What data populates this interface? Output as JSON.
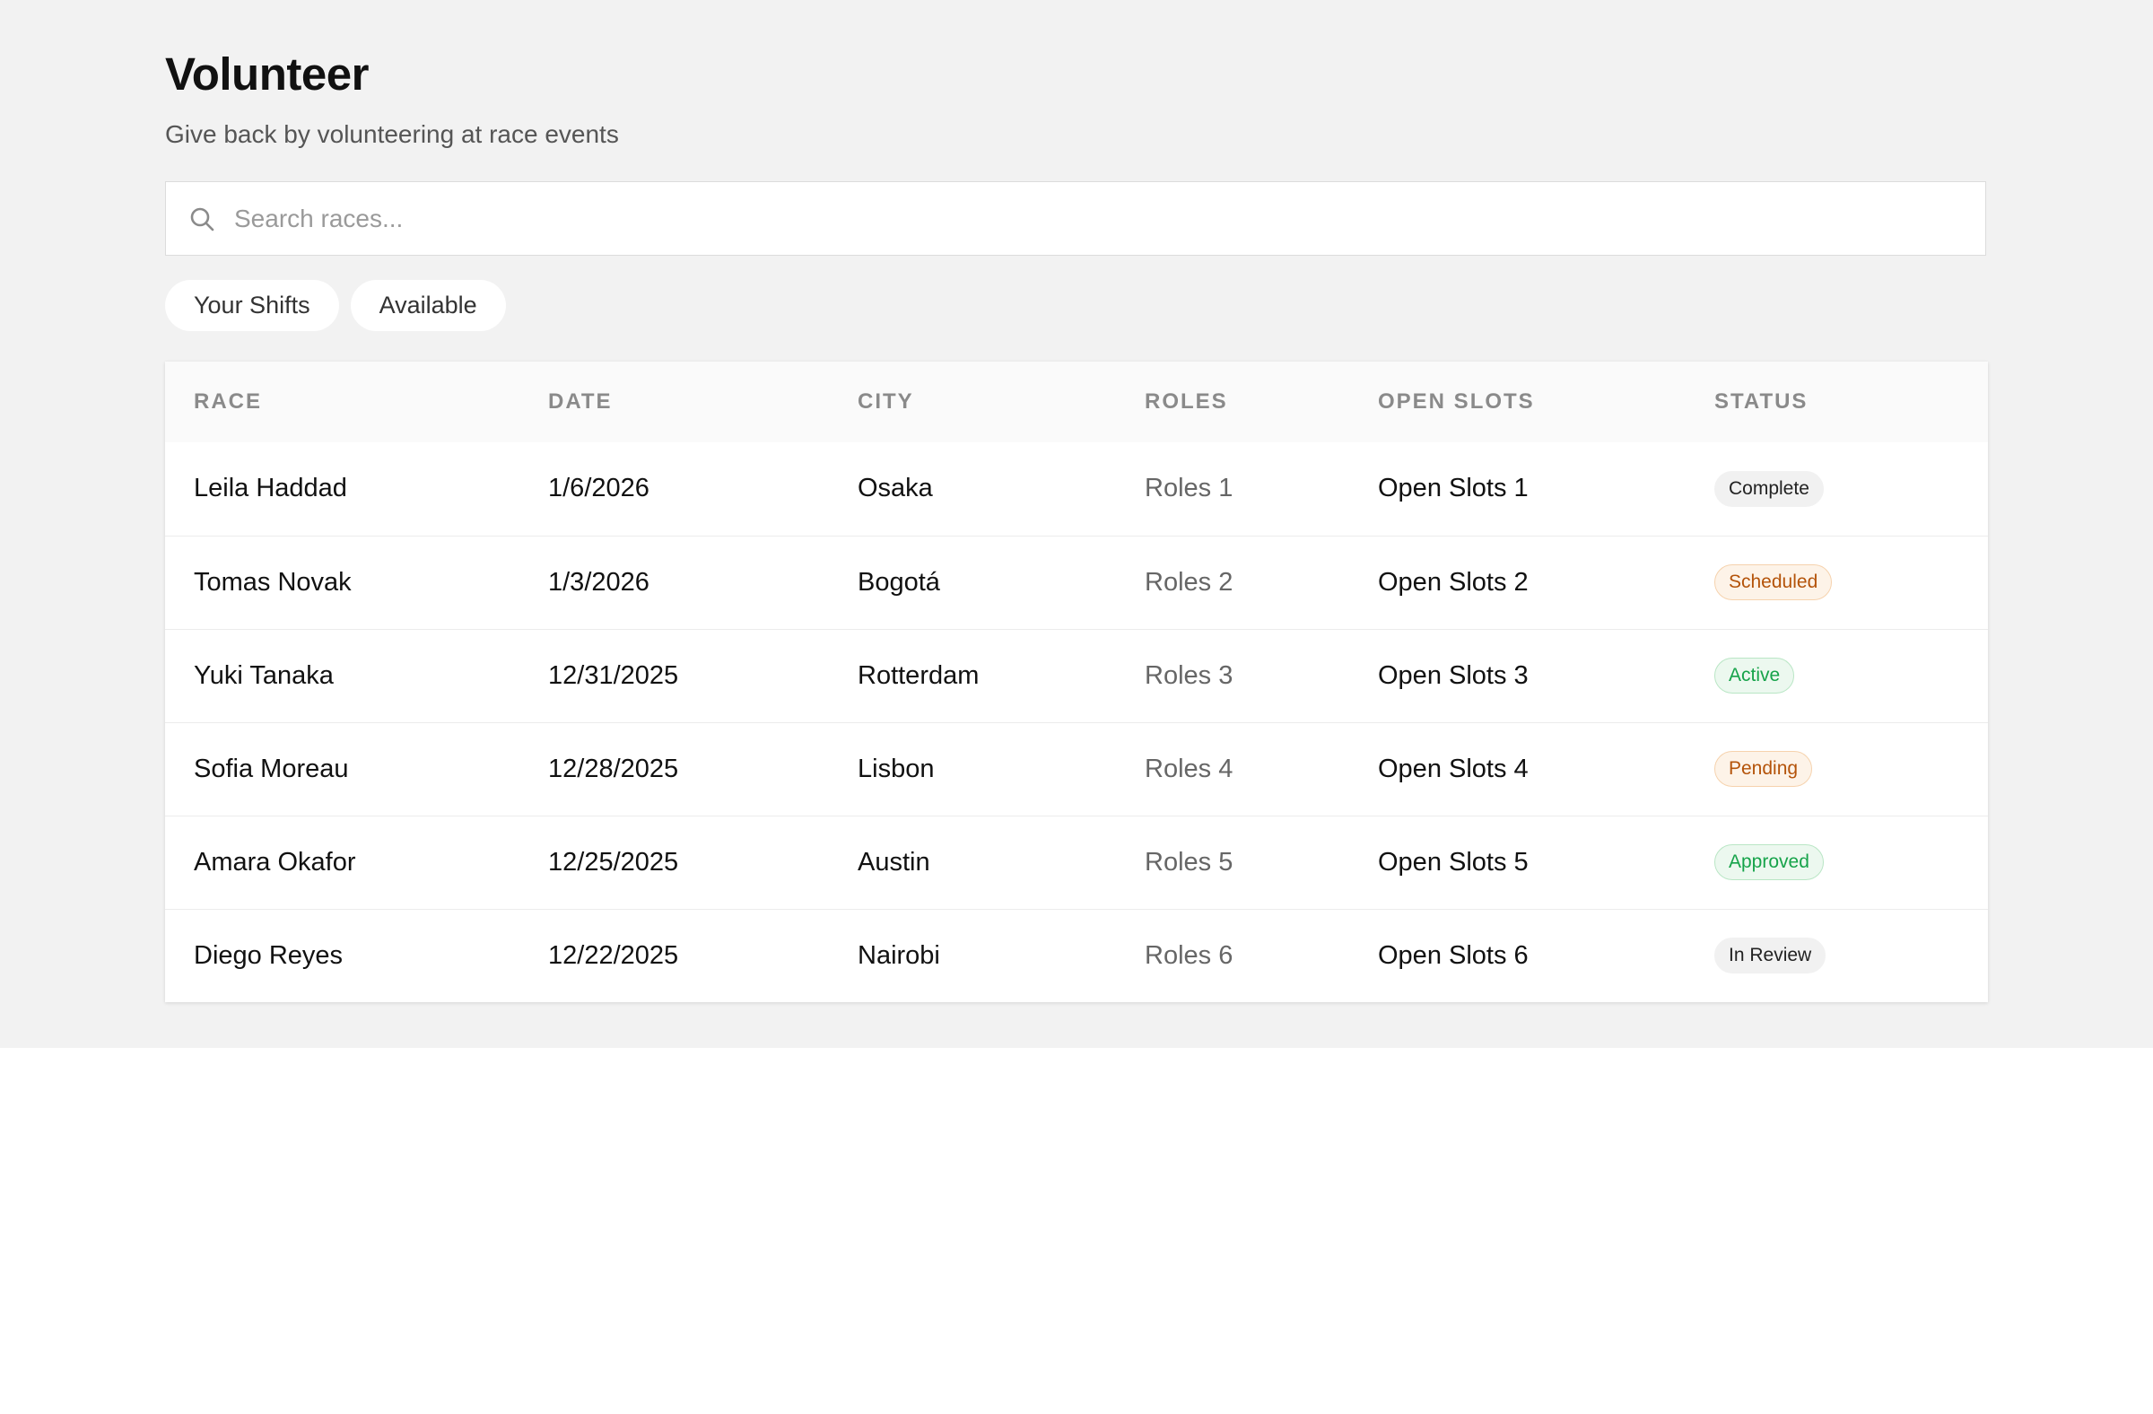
{
  "header": {
    "title": "Volunteer",
    "subtitle": "Give back by volunteering at race events"
  },
  "search": {
    "placeholder": "Search races...",
    "value": "",
    "icon": "search-icon"
  },
  "tabs": [
    {
      "label": "Your Shifts"
    },
    {
      "label": "Available"
    }
  ],
  "table": {
    "columns": [
      "RACE",
      "DATE",
      "CITY",
      "ROLES",
      "OPEN SLOTS",
      "STATUS"
    ],
    "rows": [
      {
        "race": "Leila Haddad",
        "date": "1/6/2026",
        "city": "Osaka",
        "roles": "Roles 1",
        "open_slots": "Open Slots 1",
        "status": "Complete"
      },
      {
        "race": "Tomas Novak",
        "date": "1/3/2026",
        "city": "Bogotá",
        "roles": "Roles 2",
        "open_slots": "Open Slots 2",
        "status": "Scheduled"
      },
      {
        "race": "Yuki Tanaka",
        "date": "12/31/2025",
        "city": "Rotterdam",
        "roles": "Roles 3",
        "open_slots": "Open Slots 3",
        "status": "Active"
      },
      {
        "race": "Sofia Moreau",
        "date": "12/28/2025",
        "city": "Lisbon",
        "roles": "Roles 4",
        "open_slots": "Open Slots 4",
        "status": "Pending"
      },
      {
        "race": "Amara Okafor",
        "date": "12/25/2025",
        "city": "Austin",
        "roles": "Roles 5",
        "open_slots": "Open Slots 5",
        "status": "Approved"
      },
      {
        "race": "Diego Reyes",
        "date": "12/22/2025",
        "city": "Nairobi",
        "roles": "Roles 6",
        "open_slots": "Open Slots 6",
        "status": "In Review"
      }
    ]
  },
  "colors": {
    "background": "#f2f2f2",
    "status_neutral": "#222222",
    "status_orange": "#b45309",
    "status_green": "#16a34a"
  }
}
